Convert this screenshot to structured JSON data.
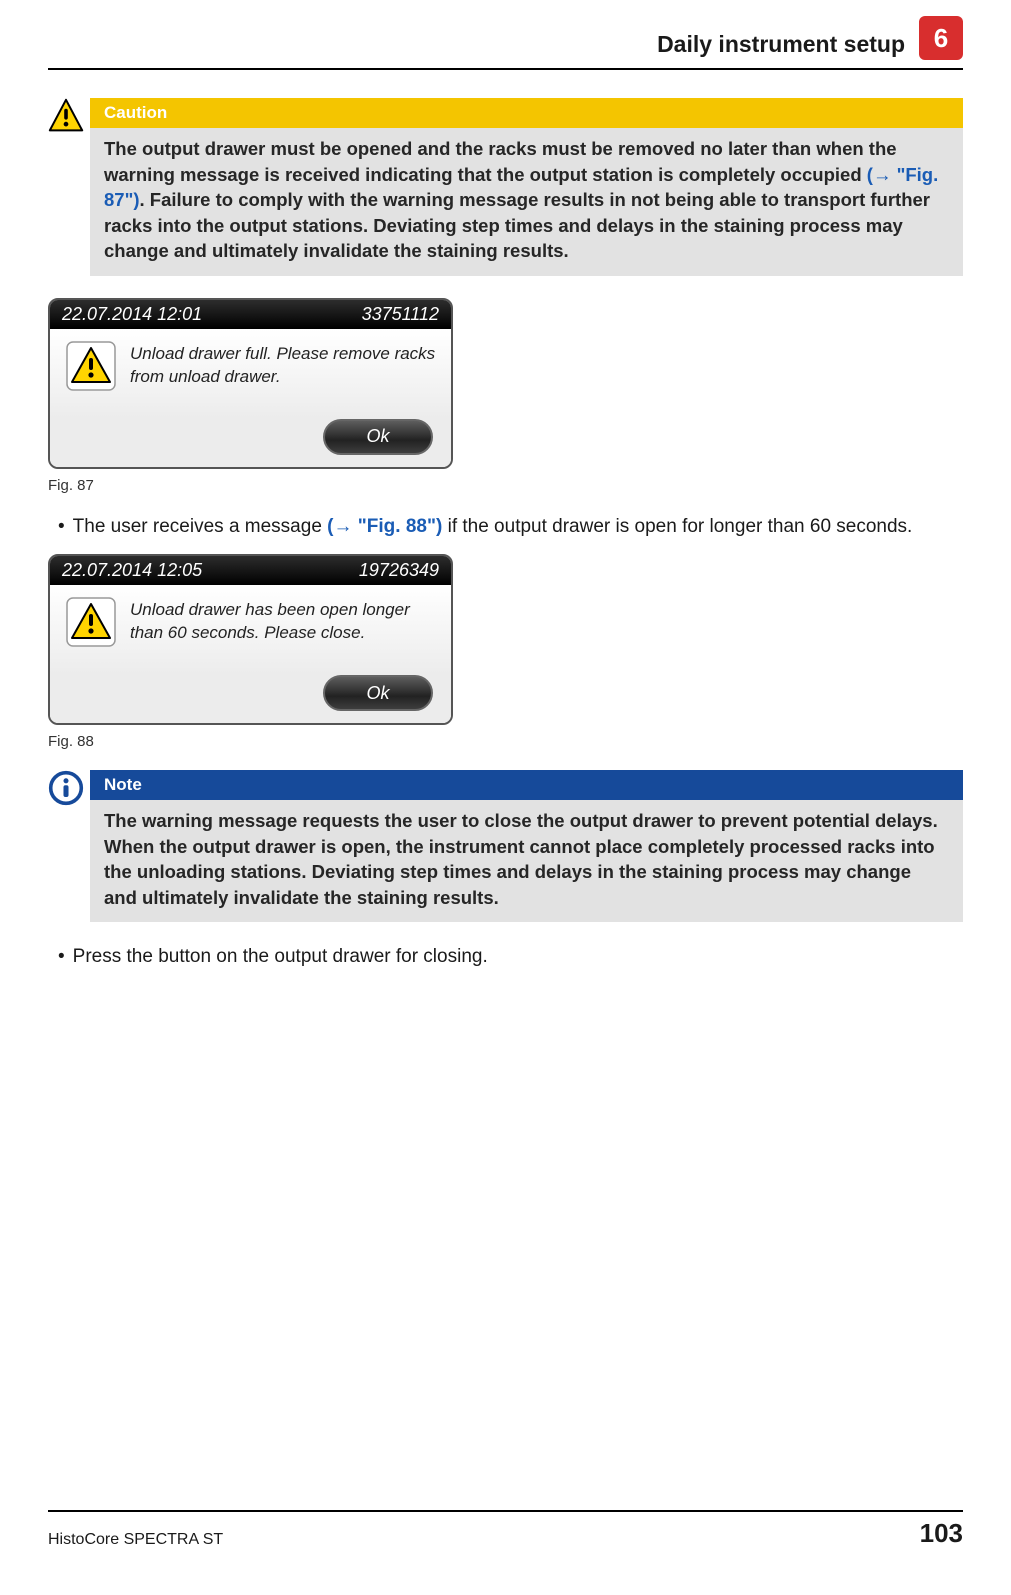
{
  "header": {
    "title": "Daily instrument setup",
    "chapter": "6"
  },
  "caution": {
    "title": "Caution",
    "body_pre": "The output drawer must be opened and the racks must be removed no later than when the warning message is received indicating that the output station is completely occupied ",
    "ref": "(→ \"Fig. 87\")",
    "body_post": ". Failure to comply with the warning message results in not being able to transport further racks into the output stations. Deviating step times and delays in the staining process may change and ultimately invalidate the staining results."
  },
  "dialog87": {
    "timestamp": "22.07.2014 12:01",
    "code": "33751112",
    "message": "Unload drawer full. Please remove racks from unload drawer.",
    "ok": "Ok",
    "caption": "Fig. 87"
  },
  "bullet1": {
    "pre": "The user receives a message ",
    "ref": "(→ \"Fig. 88\")",
    "post": " if the output drawer is open for longer than 60 seconds."
  },
  "dialog88": {
    "timestamp": "22.07.2014 12:05",
    "code": "19726349",
    "message": "Unload drawer has been open longer than 60 seconds. Please close.",
    "ok": "Ok",
    "caption": "Fig. 88"
  },
  "note": {
    "title": "Note",
    "body": "The warning message requests the user to close the output drawer to prevent potential delays. When the output drawer is open, the instrument cannot place completely processed racks into the unloading stations. Deviating step times and delays in the staining process may change and ultimately invalidate the staining results."
  },
  "bullet2": "Press the button on the output drawer for closing.",
  "footer": {
    "product": "HistoCore SPECTRA ST",
    "page": "103"
  }
}
